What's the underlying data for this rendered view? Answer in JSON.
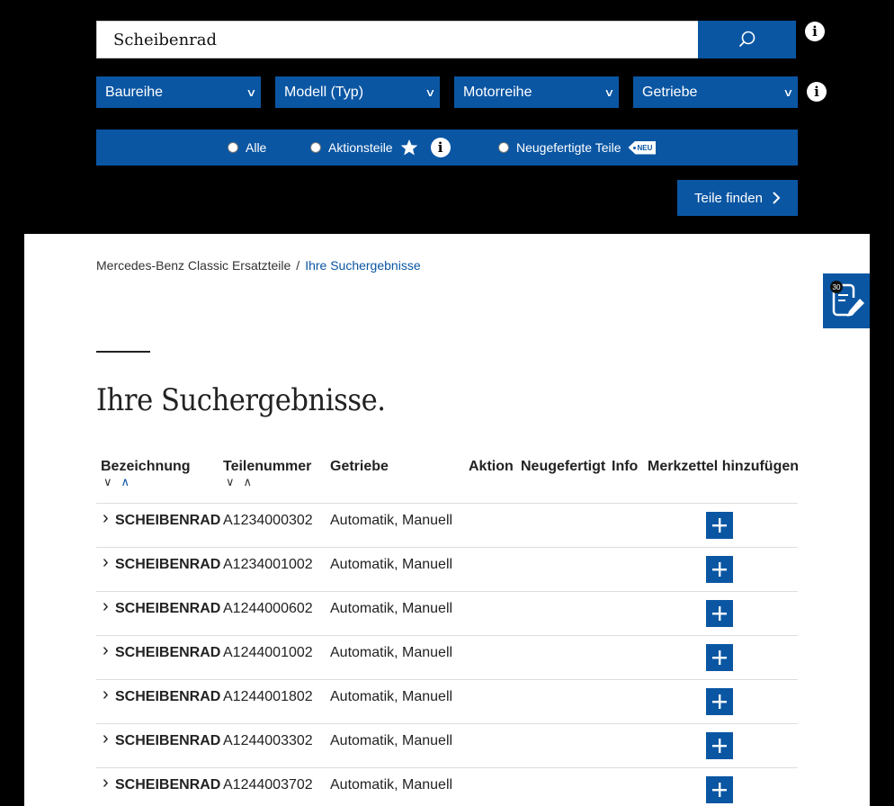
{
  "search": {
    "value": "Scheibenrad"
  },
  "filters": [
    {
      "label": "Baureihe"
    },
    {
      "label": "Modell (Typ)"
    },
    {
      "label": "Motorreihe"
    },
    {
      "label": "Getriebe"
    }
  ],
  "radio_options": [
    {
      "label": "Alle"
    },
    {
      "label": "Aktionsteile"
    },
    {
      "label": "Neugefertigte Teile"
    }
  ],
  "neu_badge": "NEU",
  "find_button": "Teile finden",
  "breadcrumb": {
    "root": "Mercedes-Benz Classic Ersatzteile",
    "separator": "/",
    "current": "Ihre Suchergebnisse"
  },
  "page_title": "Ihre Suchergebnisse.",
  "table": {
    "headers": {
      "bezeichnung": "Bezeichnung",
      "teilenummer": "Teilenummer",
      "getriebe": "Getriebe",
      "aktion": "Aktion",
      "neugefertigt": "Neugefertigt",
      "info": "Info",
      "merkzettel": "Merkzettel hinzufügen"
    },
    "rows": [
      {
        "name": "SCHEIBENRAD",
        "part": "A1234000302",
        "getriebe": "Automatik, Manuell"
      },
      {
        "name": "SCHEIBENRAD",
        "part": "A1234001002",
        "getriebe": "Automatik, Manuell"
      },
      {
        "name": "SCHEIBENRAD",
        "part": "A1244000602",
        "getriebe": "Automatik, Manuell"
      },
      {
        "name": "SCHEIBENRAD",
        "part": "A1244001002",
        "getriebe": "Automatik, Manuell"
      },
      {
        "name": "SCHEIBENRAD",
        "part": "A1244001802",
        "getriebe": "Automatik, Manuell"
      },
      {
        "name": "SCHEIBENRAD",
        "part": "A1244003302",
        "getriebe": "Automatik, Manuell"
      },
      {
        "name": "SCHEIBENRAD",
        "part": "A1244003702",
        "getriebe": "Automatik, Manuell"
      }
    ]
  },
  "notepad_count": "30",
  "colors": {
    "accent": "#0a56a3",
    "background": "#000000",
    "panel": "#ffffff"
  }
}
